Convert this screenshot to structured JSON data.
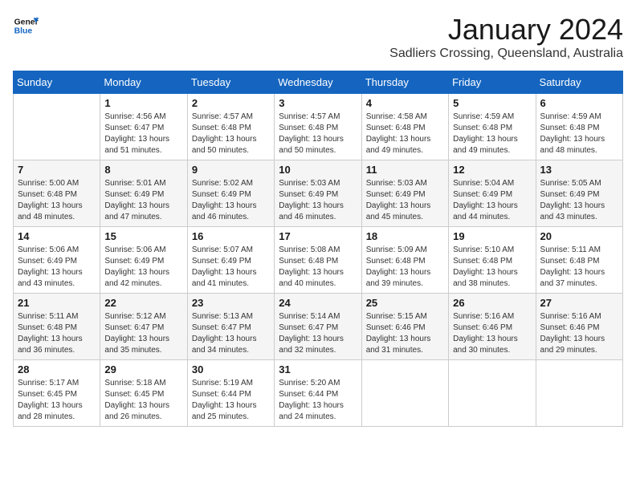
{
  "logo": {
    "text_general": "General",
    "text_blue": "Blue"
  },
  "header": {
    "month": "January 2024",
    "location": "Sadliers Crossing, Queensland, Australia"
  },
  "weekdays": [
    "Sunday",
    "Monday",
    "Tuesday",
    "Wednesday",
    "Thursday",
    "Friday",
    "Saturday"
  ],
  "weeks": [
    [
      {
        "day": "",
        "info": ""
      },
      {
        "day": "1",
        "info": "Sunrise: 4:56 AM\nSunset: 6:47 PM\nDaylight: 13 hours\nand 51 minutes."
      },
      {
        "day": "2",
        "info": "Sunrise: 4:57 AM\nSunset: 6:48 PM\nDaylight: 13 hours\nand 50 minutes."
      },
      {
        "day": "3",
        "info": "Sunrise: 4:57 AM\nSunset: 6:48 PM\nDaylight: 13 hours\nand 50 minutes."
      },
      {
        "day": "4",
        "info": "Sunrise: 4:58 AM\nSunset: 6:48 PM\nDaylight: 13 hours\nand 49 minutes."
      },
      {
        "day": "5",
        "info": "Sunrise: 4:59 AM\nSunset: 6:48 PM\nDaylight: 13 hours\nand 49 minutes."
      },
      {
        "day": "6",
        "info": "Sunrise: 4:59 AM\nSunset: 6:48 PM\nDaylight: 13 hours\nand 48 minutes."
      }
    ],
    [
      {
        "day": "7",
        "info": "Sunrise: 5:00 AM\nSunset: 6:48 PM\nDaylight: 13 hours\nand 48 minutes."
      },
      {
        "day": "8",
        "info": "Sunrise: 5:01 AM\nSunset: 6:49 PM\nDaylight: 13 hours\nand 47 minutes."
      },
      {
        "day": "9",
        "info": "Sunrise: 5:02 AM\nSunset: 6:49 PM\nDaylight: 13 hours\nand 46 minutes."
      },
      {
        "day": "10",
        "info": "Sunrise: 5:03 AM\nSunset: 6:49 PM\nDaylight: 13 hours\nand 46 minutes."
      },
      {
        "day": "11",
        "info": "Sunrise: 5:03 AM\nSunset: 6:49 PM\nDaylight: 13 hours\nand 45 minutes."
      },
      {
        "day": "12",
        "info": "Sunrise: 5:04 AM\nSunset: 6:49 PM\nDaylight: 13 hours\nand 44 minutes."
      },
      {
        "day": "13",
        "info": "Sunrise: 5:05 AM\nSunset: 6:49 PM\nDaylight: 13 hours\nand 43 minutes."
      }
    ],
    [
      {
        "day": "14",
        "info": "Sunrise: 5:06 AM\nSunset: 6:49 PM\nDaylight: 13 hours\nand 43 minutes."
      },
      {
        "day": "15",
        "info": "Sunrise: 5:06 AM\nSunset: 6:49 PM\nDaylight: 13 hours\nand 42 minutes."
      },
      {
        "day": "16",
        "info": "Sunrise: 5:07 AM\nSunset: 6:49 PM\nDaylight: 13 hours\nand 41 minutes."
      },
      {
        "day": "17",
        "info": "Sunrise: 5:08 AM\nSunset: 6:48 PM\nDaylight: 13 hours\nand 40 minutes."
      },
      {
        "day": "18",
        "info": "Sunrise: 5:09 AM\nSunset: 6:48 PM\nDaylight: 13 hours\nand 39 minutes."
      },
      {
        "day": "19",
        "info": "Sunrise: 5:10 AM\nSunset: 6:48 PM\nDaylight: 13 hours\nand 38 minutes."
      },
      {
        "day": "20",
        "info": "Sunrise: 5:11 AM\nSunset: 6:48 PM\nDaylight: 13 hours\nand 37 minutes."
      }
    ],
    [
      {
        "day": "21",
        "info": "Sunrise: 5:11 AM\nSunset: 6:48 PM\nDaylight: 13 hours\nand 36 minutes."
      },
      {
        "day": "22",
        "info": "Sunrise: 5:12 AM\nSunset: 6:47 PM\nDaylight: 13 hours\nand 35 minutes."
      },
      {
        "day": "23",
        "info": "Sunrise: 5:13 AM\nSunset: 6:47 PM\nDaylight: 13 hours\nand 34 minutes."
      },
      {
        "day": "24",
        "info": "Sunrise: 5:14 AM\nSunset: 6:47 PM\nDaylight: 13 hours\nand 32 minutes."
      },
      {
        "day": "25",
        "info": "Sunrise: 5:15 AM\nSunset: 6:46 PM\nDaylight: 13 hours\nand 31 minutes."
      },
      {
        "day": "26",
        "info": "Sunrise: 5:16 AM\nSunset: 6:46 PM\nDaylight: 13 hours\nand 30 minutes."
      },
      {
        "day": "27",
        "info": "Sunrise: 5:16 AM\nSunset: 6:46 PM\nDaylight: 13 hours\nand 29 minutes."
      }
    ],
    [
      {
        "day": "28",
        "info": "Sunrise: 5:17 AM\nSunset: 6:45 PM\nDaylight: 13 hours\nand 28 minutes."
      },
      {
        "day": "29",
        "info": "Sunrise: 5:18 AM\nSunset: 6:45 PM\nDaylight: 13 hours\nand 26 minutes."
      },
      {
        "day": "30",
        "info": "Sunrise: 5:19 AM\nSunset: 6:44 PM\nDaylight: 13 hours\nand 25 minutes."
      },
      {
        "day": "31",
        "info": "Sunrise: 5:20 AM\nSunset: 6:44 PM\nDaylight: 13 hours\nand 24 minutes."
      },
      {
        "day": "",
        "info": ""
      },
      {
        "day": "",
        "info": ""
      },
      {
        "day": "",
        "info": ""
      }
    ]
  ]
}
